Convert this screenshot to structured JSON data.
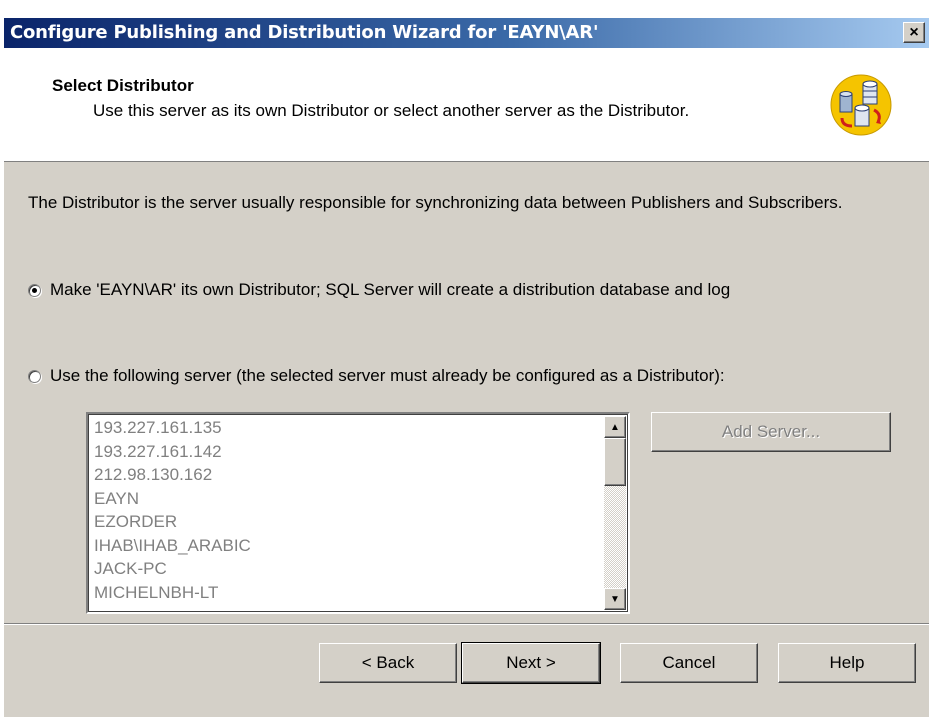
{
  "window": {
    "title": "Configure Publishing and Distribution Wizard for 'EAYN\\AR'",
    "close_label": "×"
  },
  "header": {
    "title": "Select Distributor",
    "subtitle": "Use this server as its own Distributor or select another server as the Distributor.",
    "icon": "server-replication-icon"
  },
  "content": {
    "description": "The Distributor is the server usually responsible for synchronizing data between Publishers and Subscribers.",
    "option_own": {
      "label": "Make 'EAYN\\AR' its own Distributor; SQL Server will create a distribution database and log",
      "checked": true
    },
    "option_other": {
      "label": "Use the following server (the selected server must already be configured as a Distributor):",
      "checked": false
    },
    "servers": [
      "193.227.161.135",
      "193.227.161.142",
      "212.98.130.162",
      "EAYN",
      "EZORDER",
      "IHAB\\IHAB_ARABIC",
      "JACK-PC",
      "MICHELNBH-LT"
    ],
    "add_server_label": "Add Server..."
  },
  "footer": {
    "back_label": "< Back",
    "next_label": "Next >",
    "cancel_label": "Cancel",
    "help_label": "Help"
  },
  "colors": {
    "titlebar_start": "#0a246a",
    "titlebar_end": "#a6caf0",
    "dialog_face": "#d4d0c8"
  }
}
